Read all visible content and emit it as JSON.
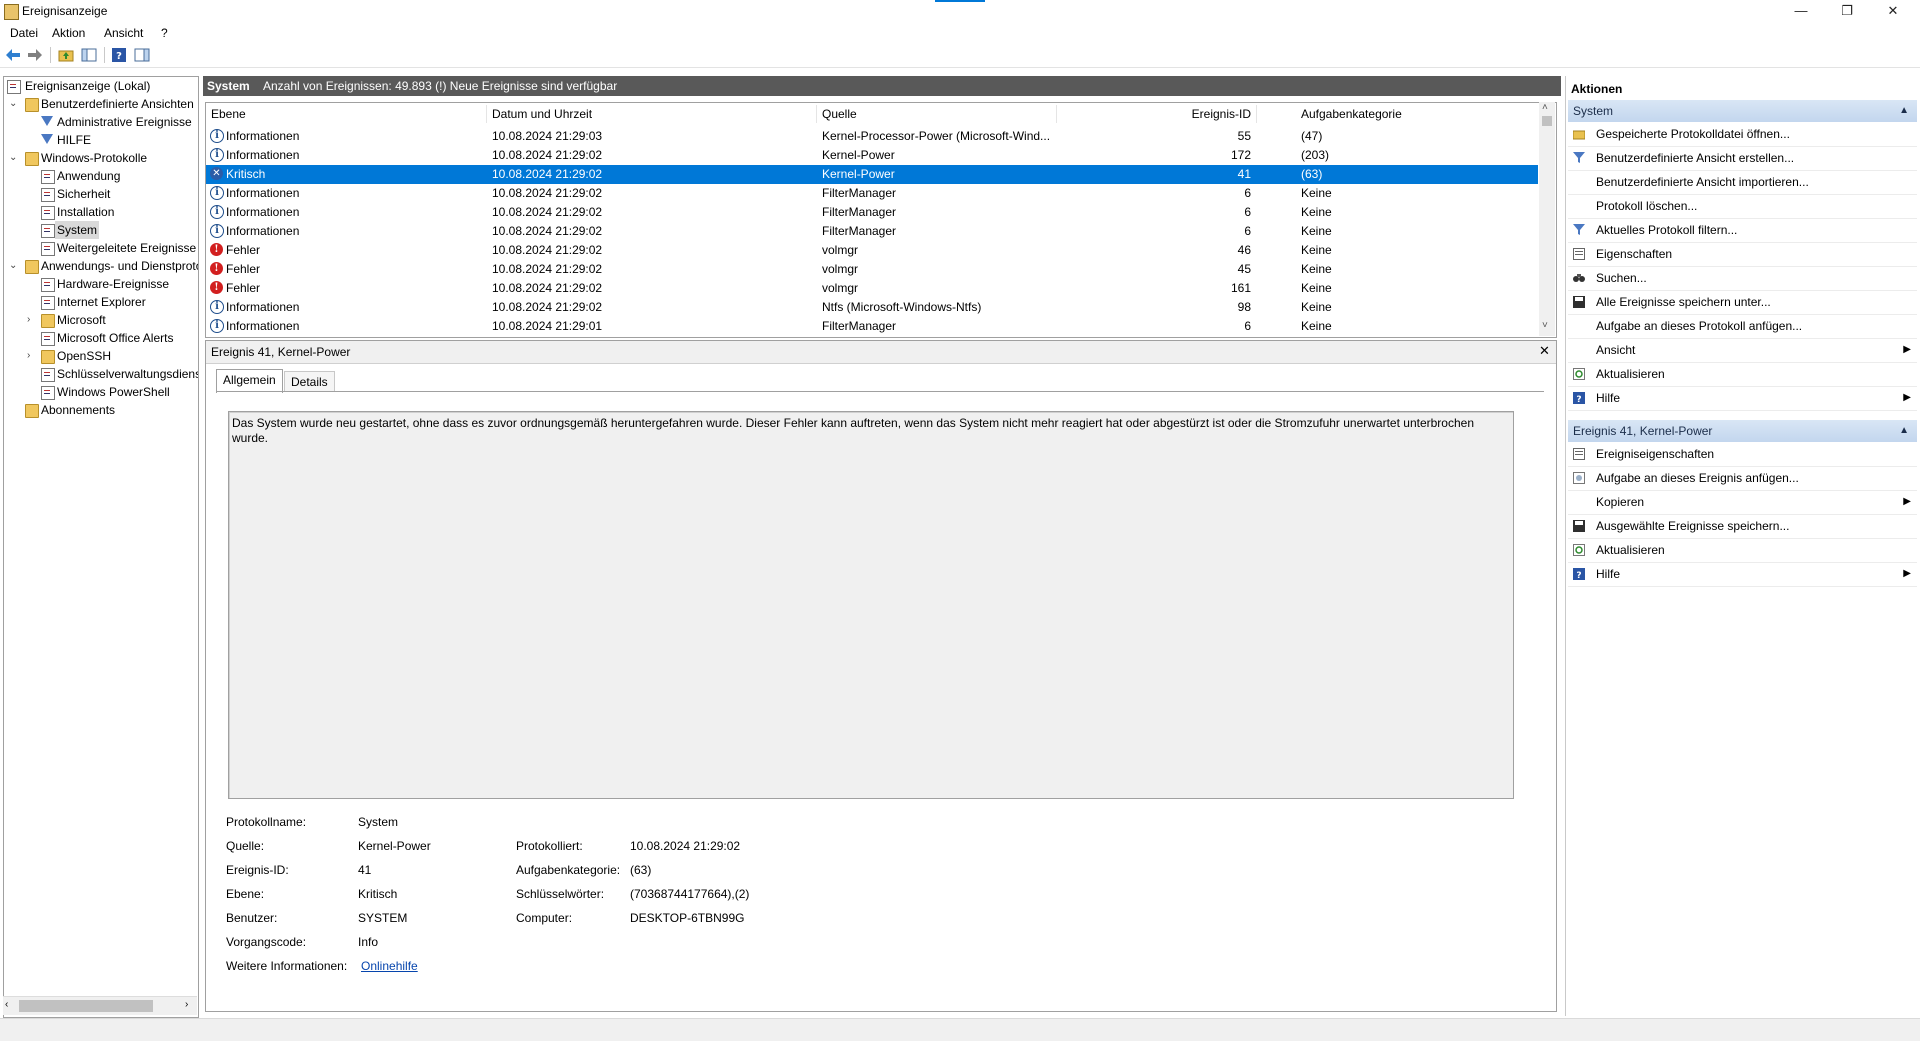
{
  "window": {
    "title": "Ereignisanzeige",
    "minimize": "—",
    "maximize": "❐",
    "close": "✕"
  },
  "menu": [
    "Datei",
    "Aktion",
    "Ansicht",
    "?"
  ],
  "tree": {
    "root": "Ereignisanzeige (Lokal)",
    "items": [
      {
        "label": "Benutzerdefinierte Ansichten",
        "level": 1,
        "icon": "folder",
        "arrow": "v"
      },
      {
        "label": "Administrative Ereignisse",
        "level": 2,
        "icon": "filter"
      },
      {
        "label": "HILFE",
        "level": 2,
        "icon": "filter"
      },
      {
        "label": "Windows-Protokolle",
        "level": 1,
        "icon": "folder",
        "arrow": "v"
      },
      {
        "label": "Anwendung",
        "level": 2,
        "icon": "log"
      },
      {
        "label": "Sicherheit",
        "level": 2,
        "icon": "log"
      },
      {
        "label": "Installation",
        "level": 2,
        "icon": "log"
      },
      {
        "label": "System",
        "level": 2,
        "icon": "log",
        "selected": true
      },
      {
        "label": "Weitergeleitete Ereignisse",
        "level": 2,
        "icon": "log"
      },
      {
        "label": "Anwendungs- und Dienstprotokolle",
        "level": 1,
        "icon": "folder",
        "arrow": "v"
      },
      {
        "label": "Hardware-Ereignisse",
        "level": 2,
        "icon": "log"
      },
      {
        "label": "Internet Explorer",
        "level": 2,
        "icon": "log"
      },
      {
        "label": "Microsoft",
        "level": 2,
        "icon": "folder",
        "arrow": ">"
      },
      {
        "label": "Microsoft Office Alerts",
        "level": 2,
        "icon": "log"
      },
      {
        "label": "OpenSSH",
        "level": 2,
        "icon": "folder",
        "arrow": ">"
      },
      {
        "label": "Schlüsselverwaltungsdienst",
        "level": 2,
        "icon": "log"
      },
      {
        "label": "Windows PowerShell",
        "level": 2,
        "icon": "log"
      },
      {
        "label": "Abonnements",
        "level": 1,
        "icon": "log"
      }
    ]
  },
  "center": {
    "title": "System",
    "summary": "Anzahl von Ereignissen: 49.893 (!) Neue Ereignisse sind verfügbar"
  },
  "table": {
    "columns": [
      "Ebene",
      "Datum und Uhrzeit",
      "Quelle",
      "Ereignis-ID",
      "Aufgabenkategorie"
    ],
    "rows": [
      {
        "level": "Informationen",
        "type": "info",
        "date": "10.08.2024 21:29:03",
        "source": "Kernel-Processor-Power (Microsoft-Wind...",
        "id": "55",
        "cat": "(47)"
      },
      {
        "level": "Informationen",
        "type": "info",
        "date": "10.08.2024 21:29:02",
        "source": "Kernel-Power",
        "id": "172",
        "cat": "(203)"
      },
      {
        "level": "Kritisch",
        "type": "crit",
        "date": "10.08.2024 21:29:02",
        "source": "Kernel-Power",
        "id": "41",
        "cat": "(63)",
        "selected": true
      },
      {
        "level": "Informationen",
        "type": "info",
        "date": "10.08.2024 21:29:02",
        "source": "FilterManager",
        "id": "6",
        "cat": "Keine"
      },
      {
        "level": "Informationen",
        "type": "info",
        "date": "10.08.2024 21:29:02",
        "source": "FilterManager",
        "id": "6",
        "cat": "Keine"
      },
      {
        "level": "Informationen",
        "type": "info",
        "date": "10.08.2024 21:29:02",
        "source": "FilterManager",
        "id": "6",
        "cat": "Keine"
      },
      {
        "level": "Fehler",
        "type": "err",
        "date": "10.08.2024 21:29:02",
        "source": "volmgr",
        "id": "46",
        "cat": "Keine"
      },
      {
        "level": "Fehler",
        "type": "err",
        "date": "10.08.2024 21:29:02",
        "source": "volmgr",
        "id": "45",
        "cat": "Keine"
      },
      {
        "level": "Fehler",
        "type": "err",
        "date": "10.08.2024 21:29:02",
        "source": "volmgr",
        "id": "161",
        "cat": "Keine"
      },
      {
        "level": "Informationen",
        "type": "info",
        "date": "10.08.2024 21:29:02",
        "source": "Ntfs (Microsoft-Windows-Ntfs)",
        "id": "98",
        "cat": "Keine"
      },
      {
        "level": "Informationen",
        "type": "info",
        "date": "10.08.2024 21:29:01",
        "source": "FilterManager",
        "id": "6",
        "cat": "Keine"
      }
    ]
  },
  "detail": {
    "title": "Ereignis 41, Kernel-Power",
    "tabs": [
      "Allgemein",
      "Details"
    ],
    "description": "Das System wurde neu gestartet, ohne dass es zuvor ordnungsgemäß heruntergefahren wurde. Dieser Fehler kann auftreten, wenn das System nicht mehr reagiert hat oder abgestürzt ist oder die Stromzufuhr unerwartet unterbrochen wurde.",
    "fields": {
      "protokollname_lbl": "Protokollname:",
      "protokollname": "System",
      "quelle_lbl": "Quelle:",
      "quelle": "Kernel-Power",
      "protokolliert_lbl": "Protokolliert:",
      "protokolliert": "10.08.2024 21:29:02",
      "id_lbl": "Ereignis-ID:",
      "id": "41",
      "aufgabe_lbl": "Aufgabenkategorie:",
      "aufgabe": "(63)",
      "ebene_lbl": "Ebene:",
      "ebene": "Kritisch",
      "keywords_lbl": "Schlüsselwörter:",
      "keywords": "(70368744177664),(2)",
      "benutzer_lbl": "Benutzer:",
      "benutzer": "SYSTEM",
      "computer_lbl": "Computer:",
      "computer": "DESKTOP-6TBN99G",
      "vorgang_lbl": "Vorgangscode:",
      "vorgang": "Info",
      "info_lbl": "Weitere Informationen:",
      "info_link": "Onlinehilfe"
    }
  },
  "actions": {
    "title": "Aktionen",
    "section1": "System",
    "items1": [
      {
        "label": "Gespeicherte Protokolldatei öffnen...",
        "icon": "open"
      },
      {
        "label": "Benutzerdefinierte Ansicht erstellen...",
        "icon": "filter"
      },
      {
        "label": "Benutzerdefinierte Ansicht importieren...",
        "icon": "none"
      },
      {
        "label": "Protokoll löschen...",
        "icon": "none"
      },
      {
        "label": "Aktuelles Protokoll filtern...",
        "icon": "filter"
      },
      {
        "label": "Eigenschaften",
        "icon": "props"
      },
      {
        "label": "Suchen...",
        "icon": "find"
      },
      {
        "label": "Alle Ereignisse speichern unter...",
        "icon": "save"
      },
      {
        "label": "Aufgabe an dieses Protokoll anfügen...",
        "icon": "none"
      },
      {
        "label": "Ansicht",
        "icon": "none",
        "sub": true
      },
      {
        "label": "Aktualisieren",
        "icon": "refresh"
      },
      {
        "label": "Hilfe",
        "icon": "help",
        "sub": true
      }
    ],
    "section2": "Ereignis 41, Kernel-Power",
    "items2": [
      {
        "label": "Ereigniseigenschaften",
        "icon": "props"
      },
      {
        "label": "Aufgabe an dieses Ereignis anfügen...",
        "icon": "task"
      },
      {
        "label": "Kopieren",
        "icon": "none",
        "sub": true
      },
      {
        "label": "Ausgewählte Ereignisse speichern...",
        "icon": "save"
      },
      {
        "label": "Aktualisieren",
        "icon": "refresh"
      },
      {
        "label": "Hilfe",
        "icon": "help",
        "sub": true
      }
    ]
  }
}
